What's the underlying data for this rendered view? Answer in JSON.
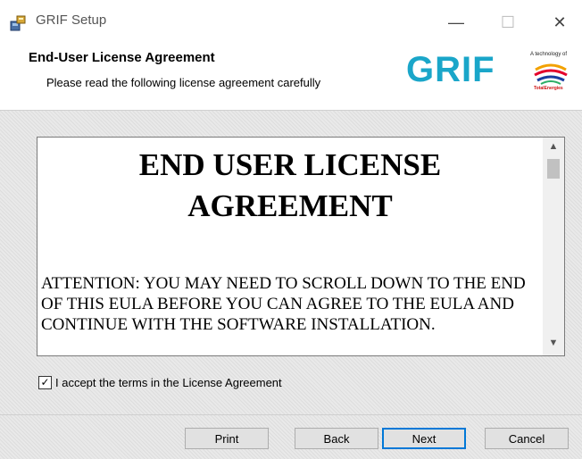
{
  "window": {
    "title": "GRIF Setup",
    "minimize_glyph": "—",
    "maximize_glyph": "☐",
    "close_glyph": "✕"
  },
  "header": {
    "title": "End-User License Agreement",
    "subtitle": "Please read the following license agreement carefully",
    "logo_text": "GRIF",
    "logo_tagline": "A technology of",
    "logo_company": "TotalEnergies"
  },
  "eula": {
    "heading": "END USER LICENSE AGREEMENT",
    "attention": "ATTENTION: YOU MAY NEED TO SCROLL DOWN TO THE END OF THIS EULA BEFORE YOU CAN AGREE TO THE EULA AND CONTINUE WITH THE SOFTWARE INSTALLATION."
  },
  "accept": {
    "checked": true,
    "check_glyph": "✓",
    "label": "I accept the terms in the License Agreement"
  },
  "buttons": {
    "print": "Print",
    "back": "Back",
    "next": "Next",
    "cancel": "Cancel"
  },
  "colors": {
    "accent": "#1aa6c9",
    "focus": "#0078d7"
  }
}
